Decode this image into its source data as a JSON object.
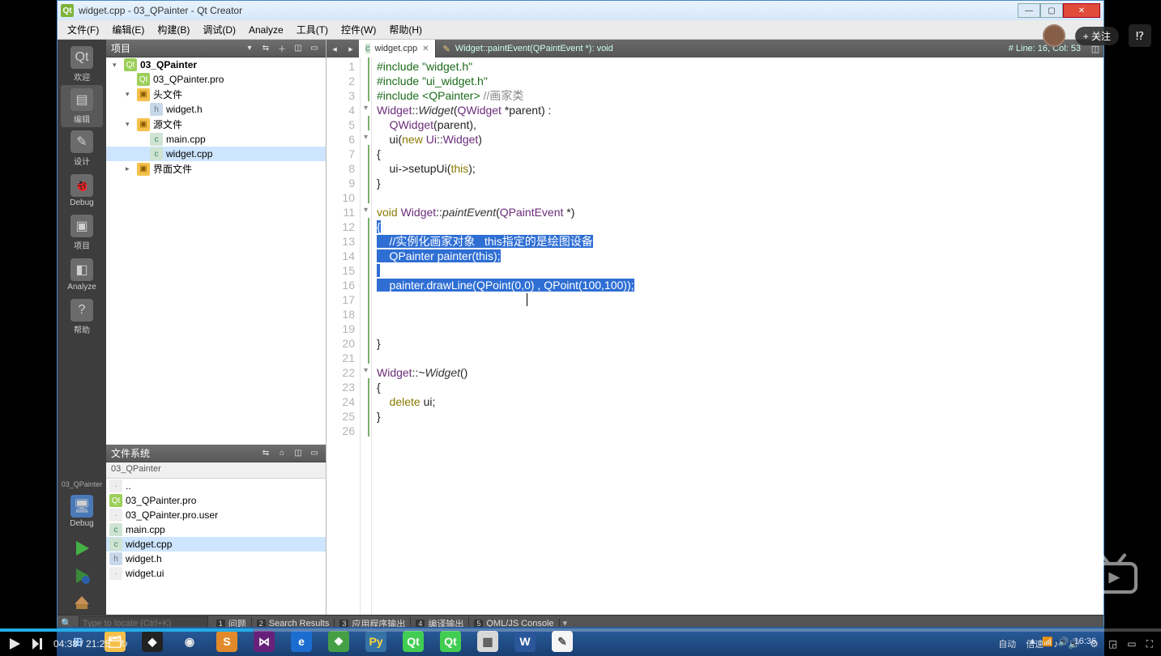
{
  "window": {
    "title": "widget.cpp - 03_QPainter - Qt Creator"
  },
  "menu": {
    "items": [
      "文件(F)",
      "编辑(E)",
      "构建(B)",
      "调试(D)",
      "Analyze",
      "工具(T)",
      "控件(W)",
      "帮助(H)"
    ]
  },
  "modebar": {
    "buttons": [
      {
        "label": "欢迎",
        "icon": "Qt"
      },
      {
        "label": "编辑",
        "icon": "▤"
      },
      {
        "label": "设计",
        "icon": "✎"
      },
      {
        "label": "Debug",
        "icon": "🐞"
      },
      {
        "label": "项目",
        "icon": "▣"
      },
      {
        "label": "Analyze",
        "icon": "◧"
      },
      {
        "label": "帮助",
        "icon": "?"
      }
    ],
    "activeIndex": 1,
    "targetLabel": "03_QPainter",
    "kitLabel": "Debug"
  },
  "projectPanel": {
    "title": "项目",
    "tree": [
      {
        "depth": 0,
        "twisty": "▾",
        "icon": "pro",
        "label": "03_QPainter",
        "bold": true
      },
      {
        "depth": 1,
        "twisty": "",
        "icon": "pro",
        "label": "03_QPainter.pro"
      },
      {
        "depth": 1,
        "twisty": "▾",
        "icon": "folder",
        "label": "头文件"
      },
      {
        "depth": 2,
        "twisty": "",
        "icon": "hdr",
        "label": "widget.h"
      },
      {
        "depth": 1,
        "twisty": "▾",
        "icon": "folder",
        "label": "源文件"
      },
      {
        "depth": 2,
        "twisty": "",
        "icon": "cpp",
        "label": "main.cpp"
      },
      {
        "depth": 2,
        "twisty": "",
        "icon": "cpp",
        "label": "widget.cpp",
        "selected": true
      },
      {
        "depth": 1,
        "twisty": "▸",
        "icon": "folder",
        "label": "界面文件"
      }
    ]
  },
  "fsPanel": {
    "title": "文件系统",
    "path": "03_QPainter",
    "items": [
      {
        "icon": "txt",
        "label": ".."
      },
      {
        "icon": "pro",
        "label": "03_QPainter.pro"
      },
      {
        "icon": "txt",
        "label": "03_QPainter.pro.user"
      },
      {
        "icon": "cpp",
        "label": "main.cpp"
      },
      {
        "icon": "cpp",
        "label": "widget.cpp",
        "selected": true
      },
      {
        "icon": "hdr",
        "label": "widget.h"
      },
      {
        "icon": "txt",
        "label": "widget.ui"
      }
    ]
  },
  "editor": {
    "tab": {
      "label": "widget.cpp",
      "icon": "cpp"
    },
    "crumb": "Widget::paintEvent(QPaintEvent *): void",
    "statusRight": "# Line: 16, Col: 53",
    "lines": [
      {
        "n": 1,
        "fold": "",
        "html": "<span class='pp'>#include</span> <span class='st'>\"widget.h\"</span>"
      },
      {
        "n": 2,
        "fold": "",
        "html": "<span class='pp'>#include</span> <span class='st'>\"ui_widget.h\"</span>"
      },
      {
        "n": 3,
        "fold": "",
        "html": "<span class='pp'>#include</span> <span class='st'>&lt;QPainter&gt;</span> <span class='cm'>//画家类</span>"
      },
      {
        "n": 4,
        "fold": "▾",
        "html": "<span class='ty'>Widget</span>::<span class='fn'>Widget</span>(<span class='ty'>QWidget</span> *parent) :"
      },
      {
        "n": 5,
        "fold": "",
        "html": "    <span class='ty'>QWidget</span>(parent),"
      },
      {
        "n": 6,
        "fold": "▾",
        "html": "    ui(<span class='kw'>new</span> <span class='ty'>Ui</span>::<span class='ty'>Widget</span>)"
      },
      {
        "n": 7,
        "fold": "",
        "html": "{"
      },
      {
        "n": 8,
        "fold": "",
        "html": "    ui-&gt;setupUi(<span class='kw'>this</span>);"
      },
      {
        "n": 9,
        "fold": "",
        "html": "}"
      },
      {
        "n": 10,
        "fold": "",
        "html": ""
      },
      {
        "n": 11,
        "fold": "▾",
        "html": "<span class='kw'>void</span> <span class='ty'>Widget</span>::<span class='fn'>paintEvent</span>(<span class='ty'>QPaintEvent</span> *)"
      },
      {
        "n": 12,
        "fold": "",
        "html": "<span class='sel'>{</span>"
      },
      {
        "n": 13,
        "fold": "",
        "html": "<span class='sel'>    //实例化画家对象   this指定的是绘图设备</span>"
      },
      {
        "n": 14,
        "fold": "",
        "html": "<span class='sel'>    QPainter painter(this);</span>"
      },
      {
        "n": 15,
        "fold": "",
        "html": "<span class='sel'> </span>"
      },
      {
        "n": 16,
        "fold": "",
        "html": "<span class='sel'>    painter.drawLine(QPoint(0,0) , QPoint(100,100));</span>"
      },
      {
        "n": 17,
        "fold": "",
        "html": "                                               <span class='text-cursor'></span>"
      },
      {
        "n": 18,
        "fold": "",
        "html": ""
      },
      {
        "n": 19,
        "fold": "",
        "html": ""
      },
      {
        "n": 20,
        "fold": "",
        "html": "}"
      },
      {
        "n": 21,
        "fold": "",
        "html": ""
      },
      {
        "n": 22,
        "fold": "▾",
        "html": "<span class='ty'>Widget</span>::~<span class='fn'>Widget</span>()"
      },
      {
        "n": 23,
        "fold": "",
        "html": "{"
      },
      {
        "n": 24,
        "fold": "",
        "html": "    <span class='kw'>delete</span> ui;"
      },
      {
        "n": 25,
        "fold": "",
        "html": "}"
      },
      {
        "n": 26,
        "fold": "",
        "html": ""
      }
    ]
  },
  "locator": {
    "searchPlaceholder": "Type to locate (Ctrl+K)",
    "tabs": [
      {
        "n": "1",
        "label": "问题"
      },
      {
        "n": "2",
        "label": "Search Results"
      },
      {
        "n": "3",
        "label": "应用程序输出"
      },
      {
        "n": "4",
        "label": "编译输出"
      },
      {
        "n": "5",
        "label": "QML/JS Console"
      }
    ]
  },
  "taskbar": {
    "apps": [
      {
        "name": "start",
        "bg": "transparent",
        "glyph": "⊞",
        "color": "#9fd2ff"
      },
      {
        "name": "explorer",
        "bg": "#f5c04a",
        "glyph": "🗂",
        "color": "#fff"
      },
      {
        "name": "unity",
        "bg": "#222",
        "glyph": "◆",
        "color": "#fff"
      },
      {
        "name": "chrome",
        "bg": "transparent",
        "glyph": "◉",
        "color": "#e8e8e8"
      },
      {
        "name": "sublime",
        "bg": "#e28a2b",
        "glyph": "S",
        "color": "#fff"
      },
      {
        "name": "visualstudio",
        "bg": "#68217a",
        "glyph": "⋈",
        "color": "#fff"
      },
      {
        "name": "edge",
        "bg": "#1c6dd0",
        "glyph": "e",
        "color": "#fff"
      },
      {
        "name": "evernote",
        "bg": "#45a045",
        "glyph": "❖",
        "color": "#fff"
      },
      {
        "name": "python",
        "bg": "#3572A5",
        "glyph": "Py",
        "color": "#ffd43b"
      },
      {
        "name": "qt1",
        "bg": "#41cd52",
        "glyph": "Qt",
        "color": "#fff"
      },
      {
        "name": "qt2",
        "bg": "#41cd52",
        "glyph": "Qt",
        "color": "#fff"
      },
      {
        "name": "app",
        "bg": "#d8d8d8",
        "glyph": "▦",
        "color": "#555"
      },
      {
        "name": "word",
        "bg": "#2b579a",
        "glyph": "W",
        "color": "#fff"
      },
      {
        "name": "notepad",
        "bg": "#f5f5f5",
        "glyph": "✎",
        "color": "#555"
      }
    ],
    "tray": {
      "labels": [
        "自动",
        "倍速"
      ],
      "icons": [
        "▲",
        "📶",
        "🔊"
      ],
      "time": "16:36"
    }
  },
  "video": {
    "followLabel": "+ 关注",
    "time": "04:38 / 21:25",
    "rightControls": [
      "自动",
      "倍速"
    ]
  }
}
